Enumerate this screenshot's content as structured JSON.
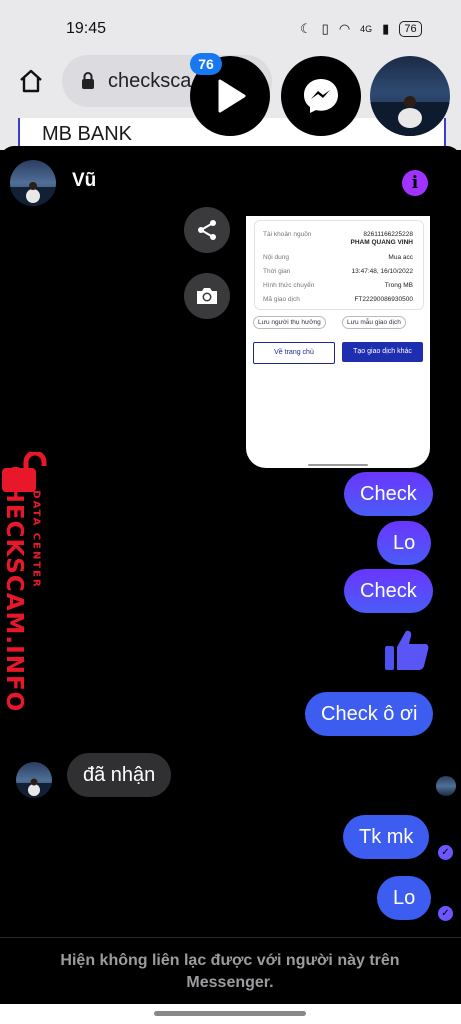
{
  "status_bar": {
    "time": "19:45",
    "battery": "76",
    "network": "4G"
  },
  "browser": {
    "url": "checksca",
    "page_text": "MB BANK"
  },
  "chat_heads": {
    "badge_count": "76"
  },
  "conversation": {
    "contact_name": "Vũ",
    "accent_color": "#a033ff"
  },
  "receipt": {
    "rows": [
      {
        "label": "Tài khoản nguồn",
        "value": "82611166225228"
      },
      {
        "label": "",
        "value": "PHAM QUANG VINH"
      },
      {
        "label": "Nội dung",
        "value": "Mua acc"
      },
      {
        "label": "Thời gian",
        "value": "13:47:48, 16/10/2022"
      },
      {
        "label": "Hình thức chuyển",
        "value": "Trong MB"
      },
      {
        "label": "Mã giao dịch",
        "value": "FT22290086930500"
      }
    ],
    "save_beneficiary": "Lưu người thụ hưởng",
    "save_template": "Lưu mẫu giao dịch",
    "home_button": "Về trang chủ",
    "new_transfer_button": "Tạo giao dịch khác"
  },
  "messages": [
    {
      "from": "me",
      "text": "Check"
    },
    {
      "from": "me",
      "text": "Lo"
    },
    {
      "from": "me",
      "text": "Check"
    },
    {
      "from": "me",
      "type": "like"
    },
    {
      "from": "me",
      "text": "Check ô ơi"
    },
    {
      "from": "them",
      "text": "đã nhận"
    },
    {
      "from": "me",
      "text": "Tk mk"
    },
    {
      "from": "me",
      "text": "Lo"
    }
  ],
  "footer": {
    "notice": "Hiện không liên lạc được với người này trên Messenger."
  },
  "watermark": {
    "main": "CHECKSCAM.INFO",
    "sub": "DATA CENTER"
  }
}
